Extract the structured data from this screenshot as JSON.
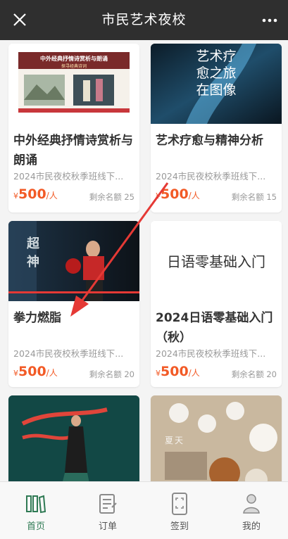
{
  "topbar": {
    "title": "市民艺术夜校",
    "close_icon": "close-icon",
    "more_icon": "more-icon"
  },
  "cards": [
    {
      "image_title": "中外经典抒情诗赏析与朗诵",
      "image_subtitle": "探寻经典诗词",
      "name": "中外经典抒情诗赏析与朗诵",
      "subtitle": "2024市民夜校秋季班线下...",
      "currency": "¥",
      "price": "500",
      "unit": "/人",
      "quota": "剩余名额 25"
    },
    {
      "image_text": "艺术疗愈之旅 在图像",
      "name": "艺术疗愈与精神分析",
      "subtitle": "2024市民夜校秋季班线下...",
      "currency": "¥",
      "price": "500",
      "unit": "/人",
      "quota": "剩余名额 15"
    },
    {
      "image_text": "超神",
      "name": "拳力燃脂",
      "subtitle": "2024市民夜校秋季班线下...",
      "currency": "¥",
      "price": "500",
      "unit": "/人",
      "quota": "剩余名额 20"
    },
    {
      "image_title": "日语零基础入门",
      "name": "2024日语零基础入门（秋）",
      "subtitle": "2024市民夜校秋季班线下...",
      "currency": "¥",
      "price": "500",
      "unit": "/人",
      "quota": "剩余名额 20"
    },
    {
      "name": "",
      "image_text": ""
    },
    {
      "image_text": "夏天"
    }
  ],
  "tabbar": [
    {
      "label": "首页",
      "icon": "home-books-icon",
      "active": true
    },
    {
      "label": "订单",
      "icon": "order-icon",
      "active": false
    },
    {
      "label": "签到",
      "icon": "checkin-icon",
      "active": false
    },
    {
      "label": "我的",
      "icon": "profile-icon",
      "active": false
    }
  ],
  "colors": {
    "accent": "#2f7a54",
    "price": "#f25a26",
    "topbar": "#2f2f2f",
    "annotation_arrow": "#e53935"
  }
}
